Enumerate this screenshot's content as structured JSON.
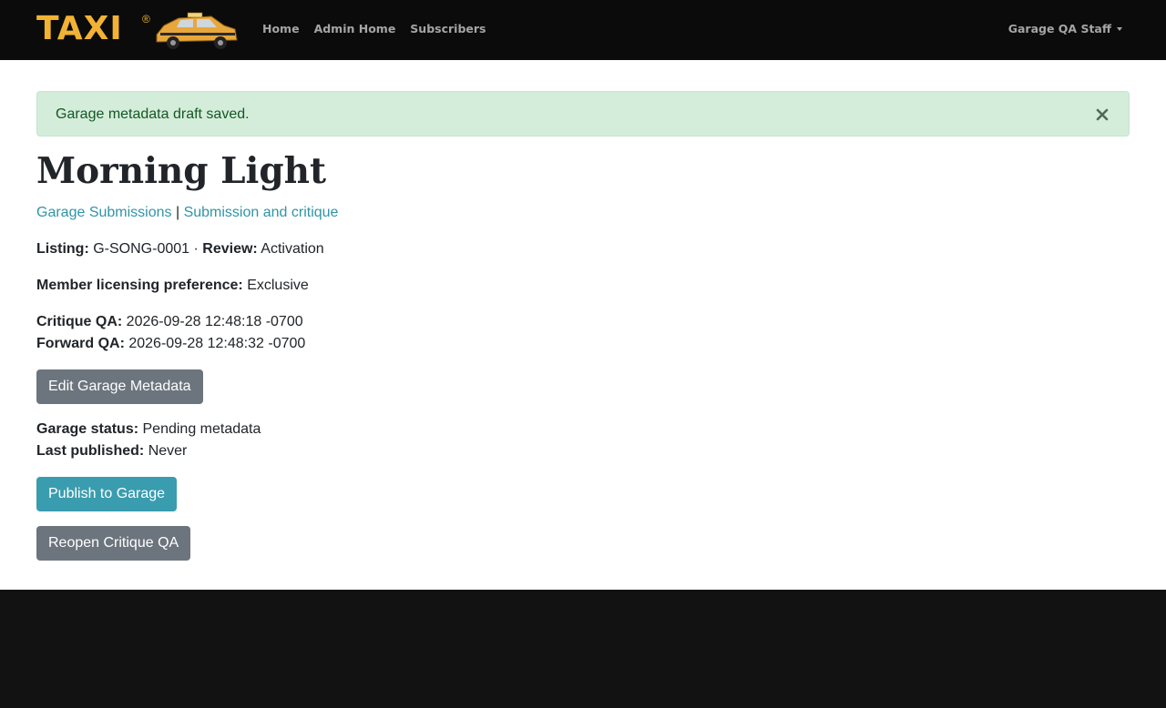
{
  "navbar": {
    "brand": "TAXI",
    "brand_mark": "®",
    "links": [
      "Home",
      "Admin Home",
      "Subscribers"
    ],
    "user_menu": "Garage QA Staff"
  },
  "alert": {
    "message": "Garage metadata draft saved.",
    "close_icon": "×"
  },
  "page": {
    "title": "Morning Light",
    "breadcrumb": {
      "link1": "Garage Submissions",
      "separator": "|",
      "link2": "Submission and critique"
    },
    "listing_label": "Listing:",
    "listing_value": "G-SONG-0001",
    "dot": "·",
    "review_label": "Review:",
    "review_value": "Activation",
    "licensing_label": "Member licensing preference:",
    "licensing_value": "Exclusive",
    "critique_qa_label": "Critique QA:",
    "critique_qa_value": "2026-09-28 12:48:18 -0700",
    "forward_qa_label": "Forward QA:",
    "forward_qa_value": "2026-09-28 12:48:32 -0700",
    "edit_button": "Edit Garage Metadata",
    "garage_status_label": "Garage status:",
    "garage_status_value": "Pending metadata",
    "last_published_label": "Last published:",
    "last_published_value": "Never",
    "publish_button": "Publish to Garage",
    "reopen_button": "Reopen Critique QA"
  },
  "colors": {
    "navbar_bg": "#0b0b0b",
    "brand": "#f2b233",
    "link": "#3194a6",
    "alert_bg": "#d4edda",
    "alert_text": "#155724",
    "btn_secondary": "#6c757d",
    "btn_info": "#3a9caf"
  }
}
